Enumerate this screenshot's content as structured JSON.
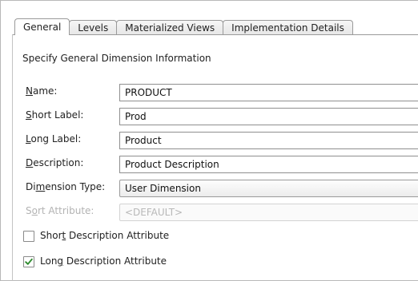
{
  "tabs": [
    {
      "label": "General",
      "active": true
    },
    {
      "label": "Levels",
      "active": false
    },
    {
      "label": "Materialized Views",
      "active": false
    },
    {
      "label": "Implementation Details",
      "active": false
    }
  ],
  "heading": "Specify General Dimension Information",
  "fields": {
    "name": {
      "pre": "",
      "mn": "N",
      "post": "ame:",
      "value": "PRODUCT"
    },
    "short_label": {
      "pre": "",
      "mn": "S",
      "post": "hort Label:",
      "value": "Prod"
    },
    "long_label": {
      "pre": "",
      "mn": "L",
      "post": "ong Label:",
      "value": "Product"
    },
    "description": {
      "pre": "",
      "mn": "D",
      "post": "escription:",
      "value": "Product Description"
    },
    "dimension_type": {
      "pre": "Di",
      "mn": "m",
      "post": "ension Type:",
      "value": "User Dimension"
    },
    "sort_attribute": {
      "pre": "S",
      "mn": "o",
      "post": "rt Attribute:",
      "value": "<DEFAULT>"
    }
  },
  "checkboxes": {
    "short_desc": {
      "pre": "Shor",
      "mn": "t",
      "post": " Description Attribute",
      "checked": false
    },
    "long_desc": {
      "pre": "Lon",
      "mn": "g",
      "post": " Description Attribute",
      "checked": true
    }
  },
  "colors": {
    "check_mark": "#2e8b2e"
  },
  "icons": {
    "check": "check-mark-icon"
  }
}
